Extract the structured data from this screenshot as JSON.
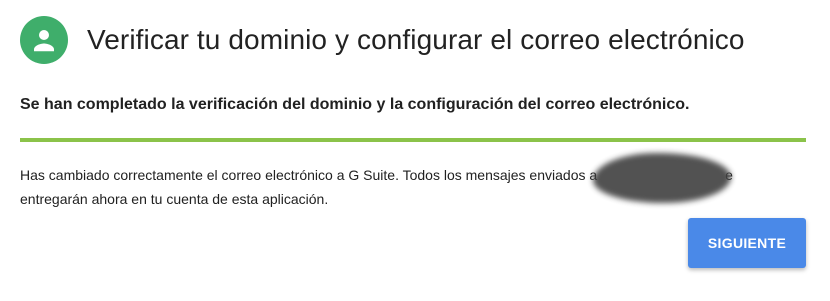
{
  "header": {
    "title": "Verificar tu dominio y configurar el correo electrónico",
    "avatar_icon": "person-icon",
    "avatar_color": "#3fae6b"
  },
  "status": {
    "heading": "Se han completado la verificación del dominio y la configuración del correo electrónico.",
    "divider_color": "#8bc34a"
  },
  "message": {
    "line1_start": "Has cambiado correctamente el correo electrónico a G Suite. Todos los mensajes enviados a",
    "redacted_icon": "redaction-blob",
    "line1_end": "e",
    "line2": "entregarán ahora en tu cuenta de esta aplicación."
  },
  "actions": {
    "next_label": "SIGUIENTE",
    "next_color": "#4a89e8"
  }
}
